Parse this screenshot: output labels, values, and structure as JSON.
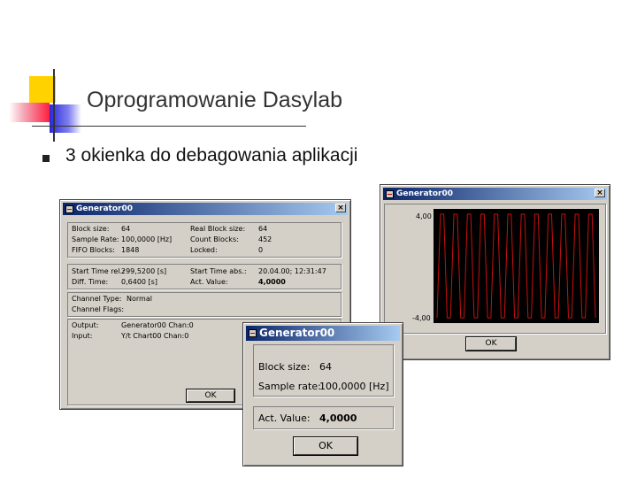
{
  "slide": {
    "title": "Oprogramowanie Dasylab",
    "bullet": "3 okienka do debagowania aplikacji"
  },
  "window_main": {
    "title": "Generator00",
    "close": "×",
    "block_size_label": "Block size:",
    "block_size_value": "64",
    "sample_rate_label": "Sample Rate:",
    "sample_rate_value": "100,0000 [Hz]",
    "fifo_label": "FIFO Blocks:",
    "fifo_value": "1848",
    "real_block_label": "Real Block size:",
    "real_block_value": "64",
    "count_blocks_label": "Count Blocks:",
    "count_blocks_value": "452",
    "locked_label": "Locked:",
    "locked_value": "0",
    "start_rel_label": "Start Time rel.:",
    "start_rel_value": "299,5200 [s]",
    "diff_time_label": "Diff. Time:",
    "diff_time_value": "0,6400 [s]",
    "start_abs_label": "Start Time abs.:",
    "start_abs_value": "20.04.00; 12:31:47",
    "act_value_label": "Act. Value:",
    "act_value_value": "4,0000",
    "channel_type_label": "Channel Type:",
    "channel_type_value": "Normal",
    "channel_flags_label": "Channel Flags:",
    "output_label": "Output:",
    "output_value": "Generator00 Chan:0",
    "input_label": "Input:",
    "input_value": "Y/t Chart00 Chan:0",
    "ok": "OK"
  },
  "window_chart": {
    "title": "Generator00",
    "close": "×",
    "y_max": "4,00",
    "y_min": "-4,00",
    "ok": "OK",
    "colors": {
      "background": "#000000",
      "trace": "#c81010"
    },
    "chart_data": {
      "type": "line",
      "title": "",
      "ylim": [
        -4,
        4
      ],
      "series": [
        {
          "values": [
            -4,
            4,
            4,
            -4,
            -4,
            4,
            4,
            -4,
            -4,
            4,
            4,
            -4,
            -4,
            4,
            4,
            -4,
            -4,
            4,
            4,
            -4,
            -4,
            4,
            4,
            -4,
            -4,
            4,
            4,
            -4,
            -4,
            4,
            4,
            -4,
            -4,
            4,
            4,
            -4,
            -4,
            4,
            4,
            -4,
            -4,
            4,
            4,
            -4,
            -4,
            4,
            4,
            -4
          ]
        }
      ]
    }
  },
  "window_small": {
    "title": "Generator00",
    "block_size_label": "Block size:",
    "block_size_value": "64",
    "sample_rate_label": "Sample rate:",
    "sample_rate_value": "100,0000 [Hz]",
    "act_value_label": "Act. Value:",
    "act_value_value": "4,0000",
    "ok": "OK"
  }
}
